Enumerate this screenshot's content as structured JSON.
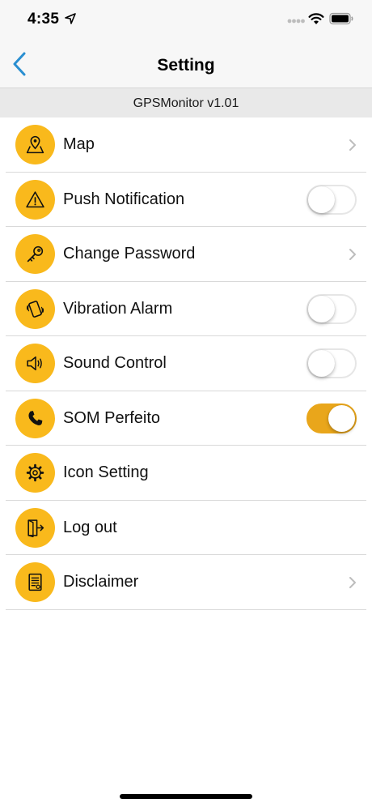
{
  "status_bar": {
    "time": "4:35"
  },
  "nav": {
    "title": "Setting"
  },
  "version": "GPSMonitor v1.01",
  "colors": {
    "accent": "#f9b91c",
    "toggle_on": "#e9a61b",
    "back": "#2a8fd1"
  },
  "items": [
    {
      "label": "Map",
      "icon": "map-pin-icon",
      "control": "chevron"
    },
    {
      "label": "Push Notification",
      "icon": "warning-icon",
      "control": "toggle",
      "on": false
    },
    {
      "label": "Change Password",
      "icon": "key-icon",
      "control": "chevron"
    },
    {
      "label": "Vibration Alarm",
      "icon": "vibration-icon",
      "control": "toggle",
      "on": false
    },
    {
      "label": "Sound Control",
      "icon": "speaker-icon",
      "control": "toggle",
      "on": false
    },
    {
      "label": "SOM Perfeito",
      "icon": "phone-icon",
      "control": "toggle",
      "on": true
    },
    {
      "label": "Icon Setting",
      "icon": "gear-icon",
      "control": "none"
    },
    {
      "label": "Log out",
      "icon": "logout-icon",
      "control": "none"
    },
    {
      "label": "Disclaimer",
      "icon": "document-icon",
      "control": "chevron"
    }
  ]
}
